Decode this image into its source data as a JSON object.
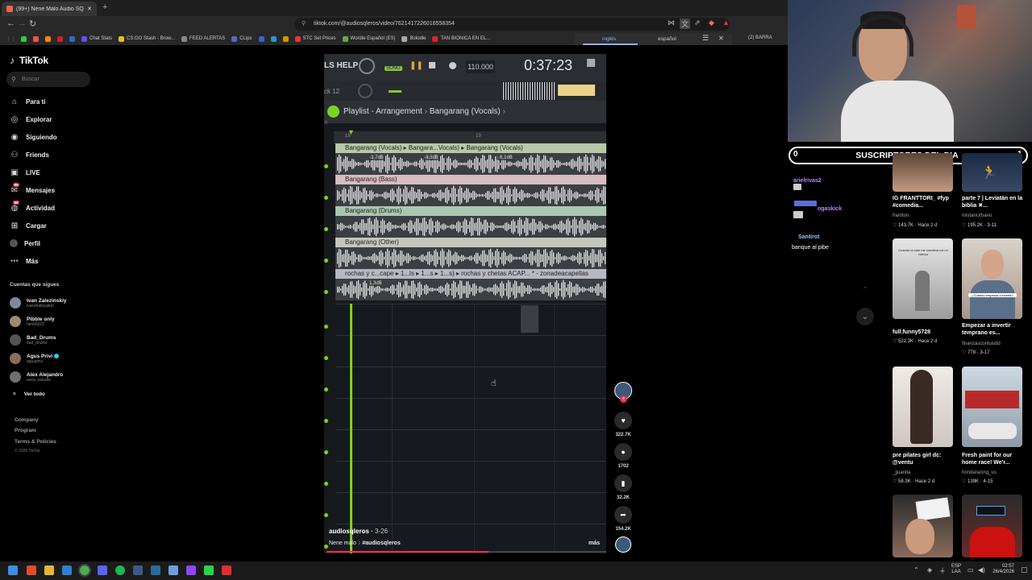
{
  "browser": {
    "tab_title": "(99+) Nene Malo Audio SQL...",
    "url": "tiktok.com/@audiosqleros/video/7621417226016558354",
    "bookmarks": [
      "Chat Stats",
      "CS:GO Stash - Brow...",
      "FEED ALERTAS",
      "CLips",
      "STC Set Prices",
      "Wordle Español (ES)",
      "Bolodle",
      "TAN BIONICA EN EL...",
      "(2) BARRA"
    ],
    "translate": {
      "lang_source": "inglés",
      "lang_target": "español"
    }
  },
  "tiktok": {
    "logo": "TikTok",
    "search_placeholder": "Buscar",
    "nav": [
      {
        "label": "Para ti",
        "icon": "home-icon"
      },
      {
        "label": "Explorar",
        "icon": "compass-icon"
      },
      {
        "label": "Siguiendo",
        "icon": "following-icon"
      },
      {
        "label": "Friends",
        "icon": "friends-icon"
      },
      {
        "label": "LIVE",
        "icon": "live-icon"
      },
      {
        "label": "Mensajes",
        "icon": "messages-icon",
        "badge": "99"
      },
      {
        "label": "Actividad",
        "icon": "activity-icon",
        "badge": "99"
      },
      {
        "label": "Cargar",
        "icon": "upload-icon"
      },
      {
        "label": "Perfil",
        "icon": "profile-icon"
      },
      {
        "label": "Más",
        "icon": "more-icon"
      }
    ],
    "following_title": "Cuentas que sigues",
    "following": [
      {
        "name": "Ivan Zalezinskiy",
        "handle": "ivanzhalizyakin"
      },
      {
        "name": "Pibble only",
        "handle": "henk5021"
      },
      {
        "name": "Bad_Drums",
        "handle": "bad_drums"
      },
      {
        "name": "Agus Privi",
        "handle": "agusprivi",
        "verified": true
      },
      {
        "name": "Alex Alejandro",
        "handle": "aoca_estudio"
      }
    ],
    "see_all": "Ver todo",
    "footer": [
      "Company",
      "Program",
      "Terms & Policies"
    ],
    "copyright": "© 2026 TikTok"
  },
  "video": {
    "daw": {
      "tempo": "110.000",
      "time": "0:37:23",
      "song_label": "SONG",
      "playlist_title": "Playlist - Arrangement",
      "pattern": "Bangarang (Vocals)",
      "ruler_marks": [
        "18",
        "19"
      ],
      "tracks": [
        {
          "label": "Bangarang (Vocals) ▸ Bangara...Vocals) ▸ Bangarang (Vocals)",
          "color": "#b9c8a9",
          "gains": [
            "-3.7dB",
            "-8.3dB",
            "-6.1dB"
          ]
        },
        {
          "label": "Bangarang (Bass)",
          "color": "#d8bcc0",
          "gains": []
        },
        {
          "label": "Bangarang (Drums)",
          "color": "#a9c8b0",
          "gains": []
        },
        {
          "label": "Bangarang (Other)",
          "color": "#c5c7bb",
          "gains": []
        },
        {
          "label": "rochas y c...cape ▸ 1...ls ▸ 1...s ▸ 1...s) ▸ rochas y chetas ACAP... * - zonadeacapellas",
          "color": "#b8b8c0",
          "gains": [
            "1.3dB"
          ]
        }
      ]
    },
    "author": "audiosqleros",
    "date": "3-26",
    "caption": "Nene malo",
    "hashtag": "#audiosqleros",
    "more": "más",
    "progress": 0.58
  },
  "actions": {
    "likes": "322.7K",
    "comments": "1702",
    "saves": "32.2K",
    "shares": "154.2K"
  },
  "stream_overlay": {
    "subs_left": "0",
    "subs_title": "SUSCRIPTORES DEL DIA",
    "subs_right": "1",
    "chat": [
      {
        "user": "arielrivas2",
        "color": "#c084fc",
        "message": ""
      },
      {
        "user": "ogaskick",
        "color": "#c084fc",
        "message": ""
      },
      {
        "user": "Santirot",
        "color": "#93c5fd",
        "message": "banque al pibe"
      }
    ]
  },
  "recommended": [
    {
      "title": "IG FRANTTORI_ #fyp #comedia...",
      "user": "frantton",
      "likes": "143.7K",
      "age": "Hace 2 d"
    },
    {
      "title": "parte 7 | Leviatán en la biblia ✖...",
      "user": "mistanUrbano",
      "likes": "195.2K",
      "age": "3-11"
    },
    {
      "title": "full.funny5728",
      "user": "",
      "likes": "522.3K",
      "age": "Hace 2 d"
    },
    {
      "title": "Empezar a invertir temprano es...",
      "user": "finanzasconluisdd",
      "likes": "778",
      "age": "3-17"
    },
    {
      "title": "pre pilates girl dc: @ventu",
      "user": "_jjuanita",
      "likes": "58.3K",
      "age": "Hace 2 d"
    },
    {
      "title": "Fresh paint for our home race! We'r...",
      "user": "hondaracing_us",
      "likes": "139K",
      "age": "4-15"
    }
  ],
  "thumb_overlays": {
    "walker": "Cuando la cam me combina con el cuerpo",
    "investor": "¿Cuándo empezar a invertir?"
  },
  "taskbar": {
    "lang": "ESP",
    "lang_sub": "LAA",
    "time": "02:57",
    "date": "26/4/2026"
  }
}
